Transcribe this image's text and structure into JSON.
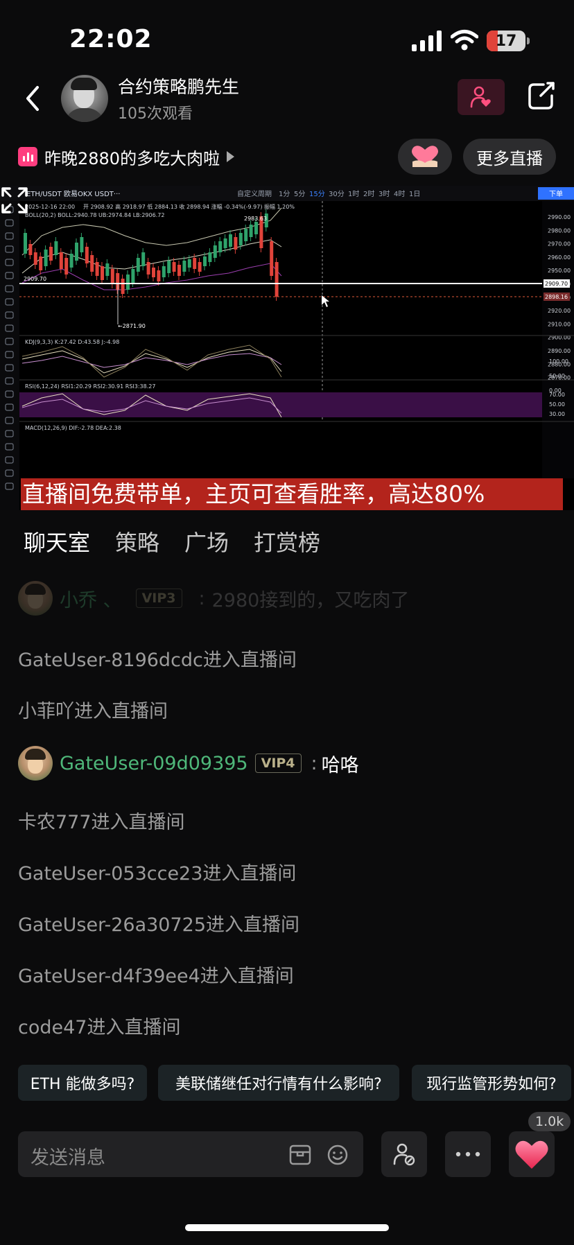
{
  "status_bar": {
    "time": "22:02",
    "battery": "17"
  },
  "header": {
    "host_name": "合约策略鹏先生",
    "views": "105次观看"
  },
  "topic": {
    "title": "昨晚2880的多吃大肉啦"
  },
  "more_live_label": "更多直播",
  "video": {
    "banner": "直播间免费带单，主页可查看胜率，高达80%",
    "chart_header": {
      "symbol": "ETH/USDT 欧易OKX USDT···",
      "interval_selected": "15分",
      "intervals": [
        "1分",
        "5分",
        "15分",
        "30分",
        "1时",
        "2时",
        "3时",
        "4时",
        "1日"
      ],
      "custom_interval": "自定义周期",
      "date": "2025-12-16 22:00",
      "ohlc": "开 2908.92  高 2918.97  低 2884.13  收 2898.94  涨幅 -0.34%(-9.97)  振幅 1.20%",
      "boll": "BOLL(20,2)  BOLL:2940.78  UB:2974.84  LB:2906.72",
      "kdj": "KDJ(9,3,3)  K:27.42  D:43.58  J:-4.98",
      "rsi": "RSI(6,12,24)  RSI1:20.29  RSI2:30.91  RSI3:38.27",
      "macd": "MACD(12,26,9)  DIF:-2.78  DEA:2.38",
      "order_btn": "下单",
      "price_high_label": "2983.63",
      "price_low_label": "2871.90",
      "current_line_label": "2909.70",
      "current_price_tag": "2909.70",
      "last_price_tag": "2898.16",
      "y_ticks": [
        "2990.00",
        "2980.00",
        "2970.00",
        "2960.00",
        "2950.00",
        "2940.00",
        "2930.00",
        "2920.00",
        "2910.00",
        "2900.00",
        "2890.00",
        "2880.00",
        "2870.00"
      ],
      "kdj_ticks": [
        "100.00",
        "50.00",
        "0.00"
      ],
      "rsi_ticks": [
        "70.00",
        "50.00",
        "30.00"
      ]
    }
  },
  "tabs": [
    "聊天室",
    "策略",
    "广场",
    "打赏榜"
  ],
  "chat": {
    "faded": {
      "user": "小乔 、",
      "vip": "VIP3",
      "colon": ":",
      "text": "2980接到的，又吃肉了"
    },
    "messages_1": [
      "GateUser-8196dcdc进入直播间",
      "小菲吖进入直播间"
    ],
    "highlight": {
      "user": "GateUser-09d09395",
      "vip": "VIP4",
      "colon": ":",
      "text": "哈咯"
    },
    "messages_2": [
      "卡农777进入直播间",
      "GateUser-053cce23进入直播间",
      "GateUser-26a30725进入直播间",
      "GateUser-d4f39ee4进入直播间",
      "code47进入直播间"
    ]
  },
  "suggestions": [
    "ETH 能做多吗?",
    "美联储继任对行情有什么影响?",
    "现行监管形势如何?"
  ],
  "input": {
    "placeholder": "发送消息"
  },
  "likes": "1.0k",
  "colors": {
    "accent_pink": "#ff3d7f",
    "green_user": "#4fb87a",
    "banner_red": "#b3241c"
  }
}
